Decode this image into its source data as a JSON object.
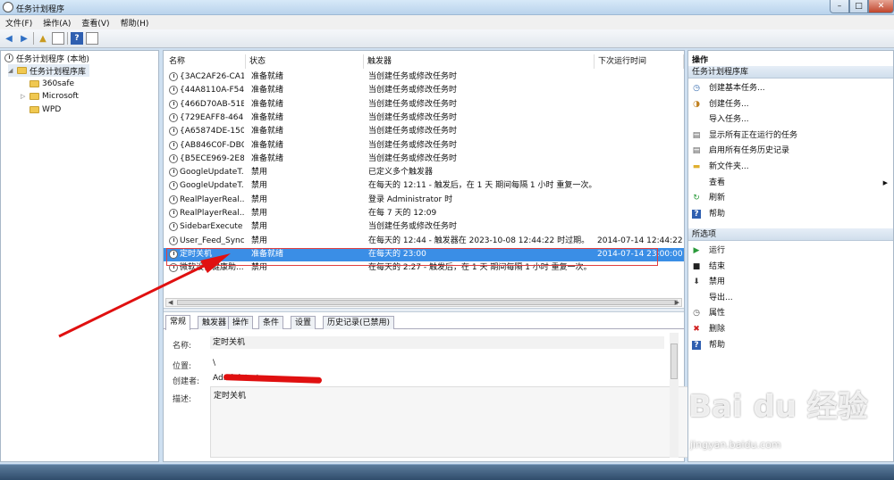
{
  "window": {
    "title": "任务计划程序"
  },
  "menu": [
    "文件(F)",
    "操作(A)",
    "查看(V)",
    "帮助(H)"
  ],
  "tree": {
    "root": "任务计划程序 (本地)",
    "library": "任务计划程序库",
    "folders": [
      "360safe",
      "Microsoft",
      "WPD"
    ]
  },
  "task_list": {
    "columns": [
      "名称",
      "状态",
      "触发器",
      "下次运行时间"
    ],
    "rows": [
      {
        "name": "{3AC2AF26-CA1...",
        "status": "准备就绪",
        "trigger": "当创建任务或修改任务时",
        "next": ""
      },
      {
        "name": "{44A8110A-F54...",
        "status": "准备就绪",
        "trigger": "当创建任务或修改任务时",
        "next": ""
      },
      {
        "name": "{466D70AB-51B...",
        "status": "准备就绪",
        "trigger": "当创建任务或修改任务时",
        "next": ""
      },
      {
        "name": "{729EAFF8-4641...",
        "status": "准备就绪",
        "trigger": "当创建任务或修改任务时",
        "next": ""
      },
      {
        "name": "{A65874DE-150...",
        "status": "准备就绪",
        "trigger": "当创建任务或修改任务时",
        "next": ""
      },
      {
        "name": "{AB846C0F-DB0...",
        "status": "准备就绪",
        "trigger": "当创建任务或修改任务时",
        "next": ""
      },
      {
        "name": "{B5ECE969-2E8...",
        "status": "准备就绪",
        "trigger": "当创建任务或修改任务时",
        "next": ""
      },
      {
        "name": "GoogleUpdateT...",
        "status": "禁用",
        "trigger": "已定义多个触发器",
        "next": ""
      },
      {
        "name": "GoogleUpdateT...",
        "status": "禁用",
        "trigger": "在每天的 12:11 - 触发后，在 1 天 期间每隔 1 小时 重复一次。",
        "next": ""
      },
      {
        "name": "RealPlayerReal...",
        "status": "禁用",
        "trigger": "登录 Administrator 时",
        "next": ""
      },
      {
        "name": "RealPlayerReal...",
        "status": "禁用",
        "trigger": "在每 7 天的 12:09",
        "next": ""
      },
      {
        "name": "SidebarExecute",
        "status": "禁用",
        "trigger": "当创建任务或修改任务时",
        "next": ""
      },
      {
        "name": "User_Feed_Sync...",
        "status": "禁用",
        "trigger": "在每天的 12:44 - 触发器在 2023-10-08 12:44:22 时过期。",
        "next": "2014-07-14 12:44:22"
      },
      {
        "name": "定时关机",
        "status": "准备就绪",
        "trigger": "在每天的 23:00",
        "next": "2014-07-14 23:00:00",
        "selected": true
      },
      {
        "name": "微软设备健康助...",
        "status": "禁用",
        "trigger": "在每天的 2:27 - 触发后，在 1 天 期间每隔 1 小时 重复一次。",
        "next": ""
      }
    ]
  },
  "detail": {
    "tabs": [
      "常规",
      "触发器",
      "操作",
      "条件",
      "设置",
      "历史记录(已禁用)"
    ],
    "name_label": "名称:",
    "name_value": "定时关机",
    "location_label": "位置:",
    "location_value": "\\",
    "author_label": "创建者:",
    "author_value": "Administrator",
    "desc_label": "描述:",
    "desc_value": "定时关机"
  },
  "actions": {
    "title": "操作",
    "section1": "任务计划程序库",
    "items1": [
      {
        "label": "创建基本任务...",
        "icon": "create-basic-task-icon"
      },
      {
        "label": "创建任务...",
        "icon": "create-task-icon"
      },
      {
        "label": "导入任务...",
        "icon": ""
      },
      {
        "label": "显示所有正在运行的任务",
        "icon": "running-tasks-icon"
      },
      {
        "label": "启用所有任务历史记录",
        "icon": "history-icon"
      },
      {
        "label": "新文件夹...",
        "icon": "folder-icon"
      },
      {
        "label": "查看",
        "icon": "",
        "submenu": true
      },
      {
        "label": "刷新",
        "icon": "refresh-icon"
      },
      {
        "label": "帮助",
        "icon": "help-icon"
      }
    ],
    "section2": "所选项",
    "items2": [
      {
        "label": "运行",
        "icon": "run-icon"
      },
      {
        "label": "结束",
        "icon": "end-icon"
      },
      {
        "label": "禁用",
        "icon": "disable-icon"
      },
      {
        "label": "导出...",
        "icon": ""
      },
      {
        "label": "属性",
        "icon": "properties-icon"
      },
      {
        "label": "删除",
        "icon": "delete-icon"
      },
      {
        "label": "帮助",
        "icon": "help-icon"
      }
    ]
  },
  "watermark": {
    "logo": "Bai du 经验",
    "url": "jingyan.baidu.com"
  },
  "colors": {
    "selection": "#3a8ee6",
    "callout": "#e04040",
    "redaction": "#e01010"
  }
}
